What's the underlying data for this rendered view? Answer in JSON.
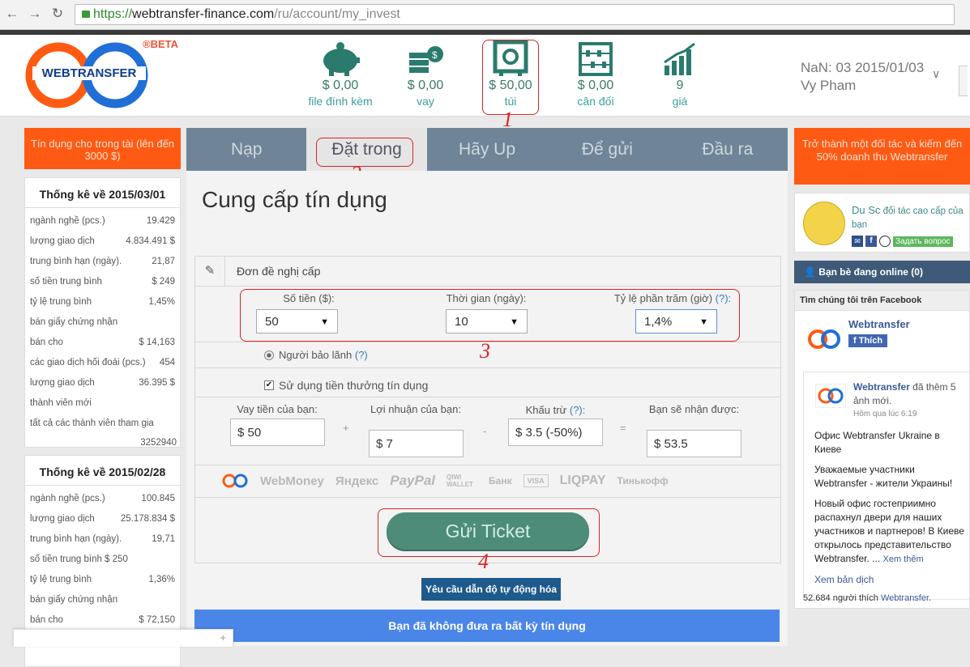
{
  "browser": {
    "url_https": "https://",
    "url_host": "webtransfer-finance.com",
    "url_path": "/ru/account/my_invest"
  },
  "header": {
    "logo_text": "WEBTRANSFER",
    "beta": "®BETA",
    "stats": [
      {
        "value": "$ 0,00",
        "label": "file đính kèm"
      },
      {
        "value": "$ 0,00",
        "label": "vay"
      },
      {
        "value": "$ 50,00",
        "label": "túi"
      },
      {
        "value": "$ 0,00",
        "label": "cân đối"
      },
      {
        "value": "9",
        "label": "giá"
      }
    ],
    "user_date": "NaN: 03 2015/01/03",
    "user_name": "Vy Pham"
  },
  "annotations": [
    "1",
    "2",
    "3",
    "4"
  ],
  "left": {
    "promo": "Tín dụng cho trong tài (lên đến 3000 $)",
    "box1": {
      "title": "Thống kê về 2015/03/01",
      "rows": [
        {
          "k": "ngành nghề (pcs.)",
          "v": "19.429"
        },
        {
          "k": "lượng giao dịch",
          "v": "4.834.491 $"
        },
        {
          "k": "trung bình hạn (ngày).",
          "v": "21,87"
        },
        {
          "k": "số tiền trung bình",
          "v": "$ 249"
        },
        {
          "k": "tỷ lệ trung bình",
          "v": "1,45%"
        },
        {
          "k": "bán giấy chứng nhận",
          "v": ""
        },
        {
          "k": "bán cho",
          "v": "$ 14,163"
        },
        {
          "k": "các giao dịch hối đoái (pcs.)",
          "v": "454"
        },
        {
          "k": "lượng giao dịch",
          "v": "36.395 $"
        },
        {
          "k": "thành viên mới",
          "v": ""
        },
        {
          "k": "tất cả các thành viên tham gia",
          "v": ""
        }
      ],
      "last": "3252940"
    },
    "box2": {
      "title": "Thống kê về 2015/02/28",
      "rows": [
        {
          "k": "ngành nghề (pcs.)",
          "v": "100.845"
        },
        {
          "k": "lượng giao dịch",
          "v": "25.178.834 $"
        },
        {
          "k": "trung bình hạn (ngày).",
          "v": "19,71"
        },
        {
          "k": "số tiền trung bình $ 250",
          "v": ""
        },
        {
          "k": "tỷ lệ trung bình",
          "v": "1,36%"
        },
        {
          "k": "bán giấy chứng nhận",
          "v": ""
        },
        {
          "k": "bán cho",
          "v": "$ 72,150"
        }
      ]
    }
  },
  "tabs": [
    "Nạp",
    "Đặt trong",
    "Hãy Up",
    "Để gửi",
    "Đầu ra"
  ],
  "main": {
    "title": "Cung cấp tín dụng",
    "panel_title": "Đơn đề nghị cấp",
    "amount_label": "Số tiền ($):",
    "amount_value": "50",
    "period_label": "Thời gian (ngày):",
    "period_value": "10",
    "rate_label": "Tỷ lệ phần trăm (giờ)",
    "rate_help": "(?):",
    "rate_value": "1,4%",
    "guarantor_label": "Người bảo lãnh",
    "guarantor_help": "(?)",
    "bonus_label": "Sử dụng tiền thưởng tín dụng",
    "loan_label": "Vay tiền của bạn:",
    "loan_value": "$ 50",
    "profit_label": "Lợi nhuận của bạn:",
    "profit_value": "$ 7",
    "deduct_label": "Khấu trừ",
    "deduct_help": "(?):",
    "deduct_value": "$ 3.5 (-50%)",
    "receive_label": "Bạn sẽ nhận được:",
    "receive_value": "$ 53.5",
    "op_plus": "+",
    "op_minus": "-",
    "op_eq": "=",
    "payments": [
      "WebMoney",
      "Яндекс",
      "PayPal",
      "QIWI WALLET",
      "Банк",
      "VISA",
      "LIQPAY",
      "Тинькофф"
    ],
    "submit": "Gửi Ticket",
    "auto_button": "Yêu cầu dẫn độ tự động hóa",
    "no_credit": "Bạn đã không đưa ra bất kỳ tín dụng"
  },
  "right": {
    "promo": "Trở thành một đối tác và kiếm đến 50% doanh thu Webtransfer",
    "partner_name": "Du Sc",
    "partner_desc": "đối tác cao cấp của bạn",
    "ask_button": "Задать вопрос",
    "friends": "Bạn bè đang online (0)",
    "fb_header": "Tìm chúng tôi trên Facebook",
    "fb_page": "Webtransfer",
    "fb_like": "Thích",
    "post_author": "Webtransfer",
    "post_action": "đã thêm 5 ảnh mới.",
    "post_time": "Hôm qua lúc 6:19",
    "post_p1": "Офис Webtransfer Ukraine в Киеве",
    "post_p2": "Уважаемые участники Webtransfer - жители Украины!",
    "post_p3": "Новый офис гостеприимно распахнул двери для наших участников и партнеров! В Киеве открылось представительство Webtransfer. ...",
    "see_more": "Xem thêm",
    "translate": "Xem bản dịch",
    "likes_text": "52.684 người thích",
    "likes_link": "Webtransfer."
  },
  "colors": {
    "accent": "#ff5a14",
    "tabbar": "#6f8597",
    "submit": "#4d8c78",
    "annot": "#dd2222"
  }
}
